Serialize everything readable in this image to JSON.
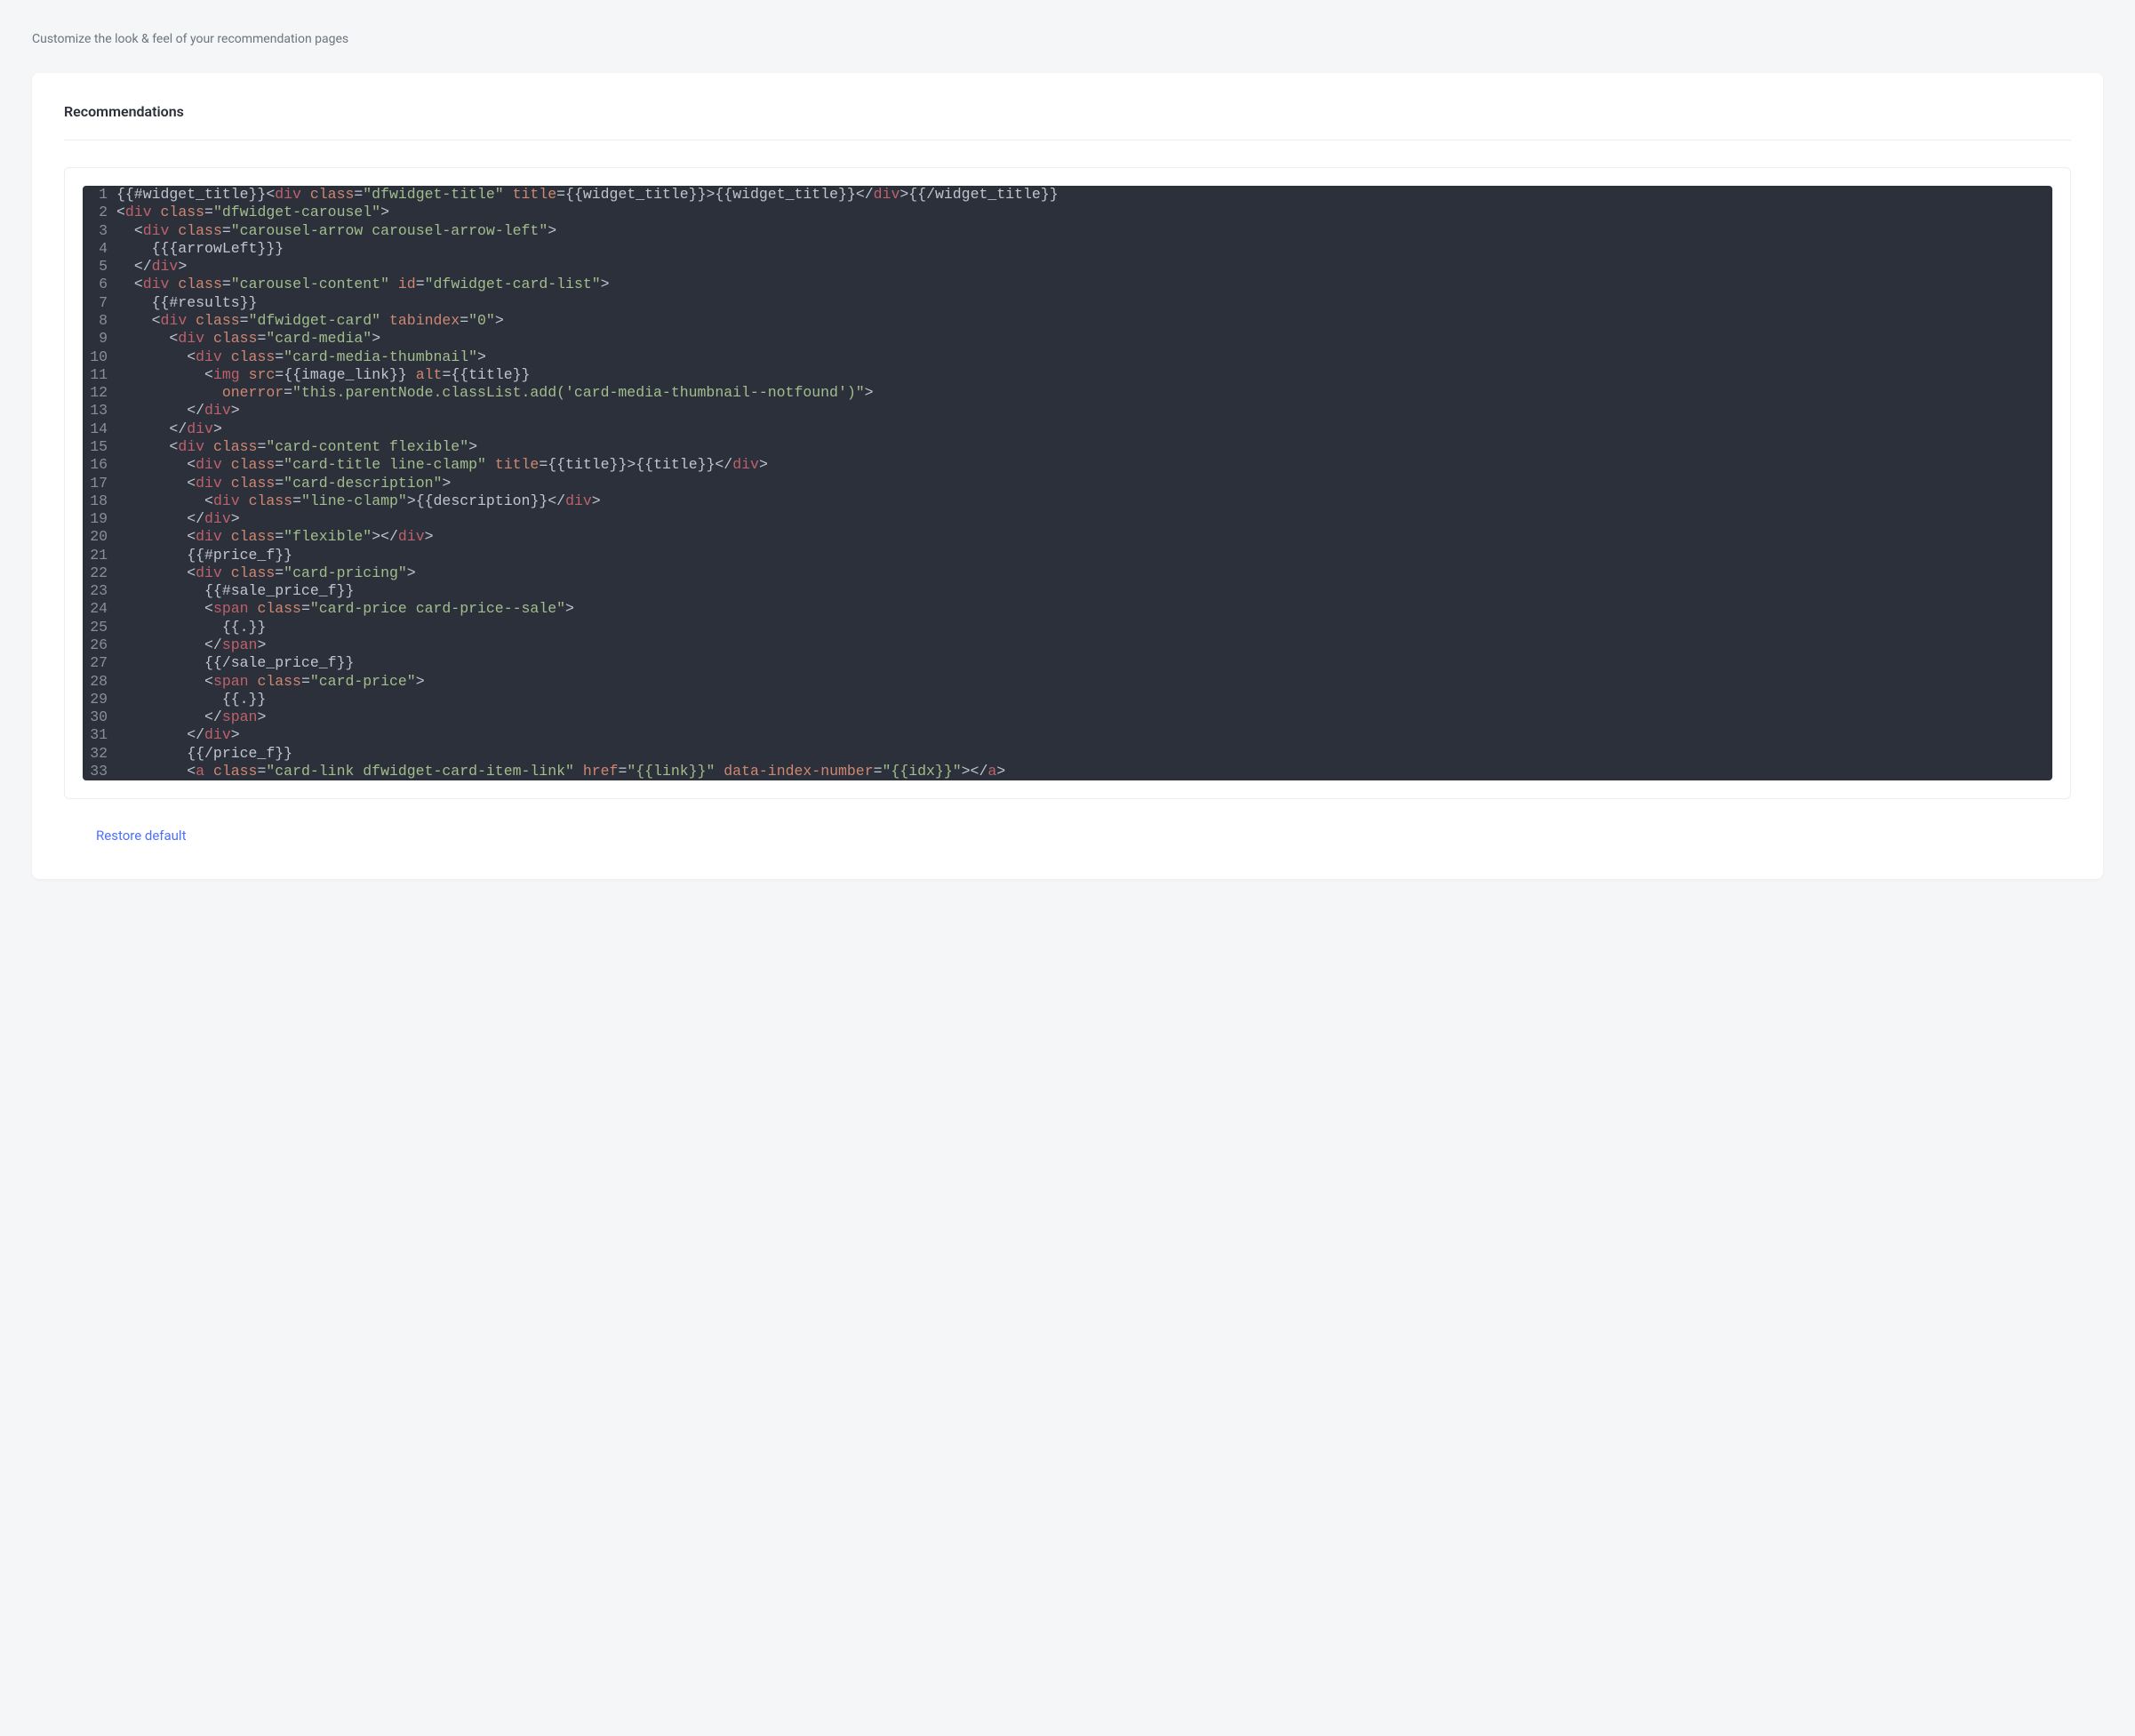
{
  "subtitle": "Customize the look & feel of your recommendation pages",
  "card_title": "Recommendations",
  "restore_label": "Restore default",
  "code_lines": [
    [
      {
        "t": "text",
        "v": "{{#widget_title}}"
      },
      {
        "t": "angle",
        "v": "<"
      },
      {
        "t": "tag",
        "v": "div"
      },
      {
        "t": "angle",
        "v": " "
      },
      {
        "t": "attr",
        "v": "class"
      },
      {
        "t": "angle",
        "v": "="
      },
      {
        "t": "val",
        "v": "\"dfwidget-title\""
      },
      {
        "t": "angle",
        "v": " "
      },
      {
        "t": "attr",
        "v": "title"
      },
      {
        "t": "angle",
        "v": "="
      },
      {
        "t": "text",
        "v": "{{widget_title}}"
      },
      {
        "t": "angle",
        "v": ">"
      },
      {
        "t": "text",
        "v": "{{widget_title}}"
      },
      {
        "t": "angle",
        "v": "</"
      },
      {
        "t": "tag",
        "v": "div"
      },
      {
        "t": "angle",
        "v": ">"
      },
      {
        "t": "text",
        "v": "{{/widget_title}}"
      }
    ],
    [
      {
        "t": "angle",
        "v": "<"
      },
      {
        "t": "tag",
        "v": "div"
      },
      {
        "t": "angle",
        "v": " "
      },
      {
        "t": "attr",
        "v": "class"
      },
      {
        "t": "angle",
        "v": "="
      },
      {
        "t": "val",
        "v": "\"dfwidget-carousel\""
      },
      {
        "t": "angle",
        "v": ">"
      }
    ],
    [
      {
        "t": "text",
        "v": "  "
      },
      {
        "t": "angle",
        "v": "<"
      },
      {
        "t": "tag",
        "v": "div"
      },
      {
        "t": "angle",
        "v": " "
      },
      {
        "t": "attr",
        "v": "class"
      },
      {
        "t": "angle",
        "v": "="
      },
      {
        "t": "val",
        "v": "\"carousel-arrow carousel-arrow-left\""
      },
      {
        "t": "angle",
        "v": ">"
      }
    ],
    [
      {
        "t": "text",
        "v": "    {{{arrowLeft}}}"
      }
    ],
    [
      {
        "t": "text",
        "v": "  "
      },
      {
        "t": "angle",
        "v": "</"
      },
      {
        "t": "tag",
        "v": "div"
      },
      {
        "t": "angle",
        "v": ">"
      }
    ],
    [
      {
        "t": "text",
        "v": "  "
      },
      {
        "t": "angle",
        "v": "<"
      },
      {
        "t": "tag",
        "v": "div"
      },
      {
        "t": "angle",
        "v": " "
      },
      {
        "t": "attr",
        "v": "class"
      },
      {
        "t": "angle",
        "v": "="
      },
      {
        "t": "val",
        "v": "\"carousel-content\""
      },
      {
        "t": "angle",
        "v": " "
      },
      {
        "t": "attr",
        "v": "id"
      },
      {
        "t": "angle",
        "v": "="
      },
      {
        "t": "val",
        "v": "\"dfwidget-card-list\""
      },
      {
        "t": "angle",
        "v": ">"
      }
    ],
    [
      {
        "t": "text",
        "v": "    {{#results}}"
      }
    ],
    [
      {
        "t": "text",
        "v": "    "
      },
      {
        "t": "angle",
        "v": "<"
      },
      {
        "t": "tag",
        "v": "div"
      },
      {
        "t": "angle",
        "v": " "
      },
      {
        "t": "attr",
        "v": "class"
      },
      {
        "t": "angle",
        "v": "="
      },
      {
        "t": "val",
        "v": "\"dfwidget-card\""
      },
      {
        "t": "angle",
        "v": " "
      },
      {
        "t": "attr",
        "v": "tabindex"
      },
      {
        "t": "angle",
        "v": "="
      },
      {
        "t": "val",
        "v": "\"0\""
      },
      {
        "t": "angle",
        "v": ">"
      }
    ],
    [
      {
        "t": "text",
        "v": "      "
      },
      {
        "t": "angle",
        "v": "<"
      },
      {
        "t": "tag",
        "v": "div"
      },
      {
        "t": "angle",
        "v": " "
      },
      {
        "t": "attr",
        "v": "class"
      },
      {
        "t": "angle",
        "v": "="
      },
      {
        "t": "val",
        "v": "\"card-media\""
      },
      {
        "t": "angle",
        "v": ">"
      }
    ],
    [
      {
        "t": "text",
        "v": "        "
      },
      {
        "t": "angle",
        "v": "<"
      },
      {
        "t": "tag",
        "v": "div"
      },
      {
        "t": "angle",
        "v": " "
      },
      {
        "t": "attr",
        "v": "class"
      },
      {
        "t": "angle",
        "v": "="
      },
      {
        "t": "val",
        "v": "\"card-media-thumbnail\""
      },
      {
        "t": "angle",
        "v": ">"
      }
    ],
    [
      {
        "t": "text",
        "v": "          "
      },
      {
        "t": "angle",
        "v": "<"
      },
      {
        "t": "tag",
        "v": "img"
      },
      {
        "t": "angle",
        "v": " "
      },
      {
        "t": "attr",
        "v": "src"
      },
      {
        "t": "angle",
        "v": "="
      },
      {
        "t": "text",
        "v": "{{image_link}}"
      },
      {
        "t": "angle",
        "v": " "
      },
      {
        "t": "attr",
        "v": "alt"
      },
      {
        "t": "angle",
        "v": "="
      },
      {
        "t": "text",
        "v": "{{title}}"
      }
    ],
    [
      {
        "t": "text",
        "v": "            "
      },
      {
        "t": "attr",
        "v": "onerror"
      },
      {
        "t": "angle",
        "v": "="
      },
      {
        "t": "val",
        "v": "\"this.parentNode.classList.add('card-media-thumbnail--notfound')\""
      },
      {
        "t": "angle",
        "v": ">"
      }
    ],
    [
      {
        "t": "text",
        "v": "        "
      },
      {
        "t": "angle",
        "v": "</"
      },
      {
        "t": "tag",
        "v": "div"
      },
      {
        "t": "angle",
        "v": ">"
      }
    ],
    [
      {
        "t": "text",
        "v": "      "
      },
      {
        "t": "angle",
        "v": "</"
      },
      {
        "t": "tag",
        "v": "div"
      },
      {
        "t": "angle",
        "v": ">"
      }
    ],
    [
      {
        "t": "text",
        "v": "      "
      },
      {
        "t": "angle",
        "v": "<"
      },
      {
        "t": "tag",
        "v": "div"
      },
      {
        "t": "angle",
        "v": " "
      },
      {
        "t": "attr",
        "v": "class"
      },
      {
        "t": "angle",
        "v": "="
      },
      {
        "t": "val",
        "v": "\"card-content flexible\""
      },
      {
        "t": "angle",
        "v": ">"
      }
    ],
    [
      {
        "t": "text",
        "v": "        "
      },
      {
        "t": "angle",
        "v": "<"
      },
      {
        "t": "tag",
        "v": "div"
      },
      {
        "t": "angle",
        "v": " "
      },
      {
        "t": "attr",
        "v": "class"
      },
      {
        "t": "angle",
        "v": "="
      },
      {
        "t": "val",
        "v": "\"card-title line-clamp\""
      },
      {
        "t": "angle",
        "v": " "
      },
      {
        "t": "attr",
        "v": "title"
      },
      {
        "t": "angle",
        "v": "="
      },
      {
        "t": "text",
        "v": "{{title}}"
      },
      {
        "t": "angle",
        "v": ">"
      },
      {
        "t": "text",
        "v": "{{title}}"
      },
      {
        "t": "angle",
        "v": "</"
      },
      {
        "t": "tag",
        "v": "div"
      },
      {
        "t": "angle",
        "v": ">"
      }
    ],
    [
      {
        "t": "text",
        "v": "        "
      },
      {
        "t": "angle",
        "v": "<"
      },
      {
        "t": "tag",
        "v": "div"
      },
      {
        "t": "angle",
        "v": " "
      },
      {
        "t": "attr",
        "v": "class"
      },
      {
        "t": "angle",
        "v": "="
      },
      {
        "t": "val",
        "v": "\"card-description\""
      },
      {
        "t": "angle",
        "v": ">"
      }
    ],
    [
      {
        "t": "text",
        "v": "          "
      },
      {
        "t": "angle",
        "v": "<"
      },
      {
        "t": "tag",
        "v": "div"
      },
      {
        "t": "angle",
        "v": " "
      },
      {
        "t": "attr",
        "v": "class"
      },
      {
        "t": "angle",
        "v": "="
      },
      {
        "t": "val",
        "v": "\"line-clamp\""
      },
      {
        "t": "angle",
        "v": ">"
      },
      {
        "t": "text",
        "v": "{{description}}"
      },
      {
        "t": "angle",
        "v": "</"
      },
      {
        "t": "tag",
        "v": "div"
      },
      {
        "t": "angle",
        "v": ">"
      }
    ],
    [
      {
        "t": "text",
        "v": "        "
      },
      {
        "t": "angle",
        "v": "</"
      },
      {
        "t": "tag",
        "v": "div"
      },
      {
        "t": "angle",
        "v": ">"
      }
    ],
    [
      {
        "t": "text",
        "v": "        "
      },
      {
        "t": "angle",
        "v": "<"
      },
      {
        "t": "tag",
        "v": "div"
      },
      {
        "t": "angle",
        "v": " "
      },
      {
        "t": "attr",
        "v": "class"
      },
      {
        "t": "angle",
        "v": "="
      },
      {
        "t": "val",
        "v": "\"flexible\""
      },
      {
        "t": "angle",
        "v": ">"
      },
      {
        "t": "angle",
        "v": "</"
      },
      {
        "t": "tag",
        "v": "div"
      },
      {
        "t": "angle",
        "v": ">"
      }
    ],
    [
      {
        "t": "text",
        "v": "        {{#price_f}}"
      }
    ],
    [
      {
        "t": "text",
        "v": "        "
      },
      {
        "t": "angle",
        "v": "<"
      },
      {
        "t": "tag",
        "v": "div"
      },
      {
        "t": "angle",
        "v": " "
      },
      {
        "t": "attr",
        "v": "class"
      },
      {
        "t": "angle",
        "v": "="
      },
      {
        "t": "val",
        "v": "\"card-pricing\""
      },
      {
        "t": "angle",
        "v": ">"
      }
    ],
    [
      {
        "t": "text",
        "v": "          {{#sale_price_f}}"
      }
    ],
    [
      {
        "t": "text",
        "v": "          "
      },
      {
        "t": "angle",
        "v": "<"
      },
      {
        "t": "tag",
        "v": "span"
      },
      {
        "t": "angle",
        "v": " "
      },
      {
        "t": "attr",
        "v": "class"
      },
      {
        "t": "angle",
        "v": "="
      },
      {
        "t": "val",
        "v": "\"card-price card-price--sale\""
      },
      {
        "t": "angle",
        "v": ">"
      }
    ],
    [
      {
        "t": "text",
        "v": "            {{.}}"
      }
    ],
    [
      {
        "t": "text",
        "v": "          "
      },
      {
        "t": "angle",
        "v": "</"
      },
      {
        "t": "tag",
        "v": "span"
      },
      {
        "t": "angle",
        "v": ">"
      }
    ],
    [
      {
        "t": "text",
        "v": "          {{/sale_price_f}}"
      }
    ],
    [
      {
        "t": "text",
        "v": "          "
      },
      {
        "t": "angle",
        "v": "<"
      },
      {
        "t": "tag",
        "v": "span"
      },
      {
        "t": "angle",
        "v": " "
      },
      {
        "t": "attr",
        "v": "class"
      },
      {
        "t": "angle",
        "v": "="
      },
      {
        "t": "val",
        "v": "\"card-price\""
      },
      {
        "t": "angle",
        "v": ">"
      }
    ],
    [
      {
        "t": "text",
        "v": "            {{.}}"
      }
    ],
    [
      {
        "t": "text",
        "v": "          "
      },
      {
        "t": "angle",
        "v": "</"
      },
      {
        "t": "tag",
        "v": "span"
      },
      {
        "t": "angle",
        "v": ">"
      }
    ],
    [
      {
        "t": "text",
        "v": "        "
      },
      {
        "t": "angle",
        "v": "</"
      },
      {
        "t": "tag",
        "v": "div"
      },
      {
        "t": "angle",
        "v": ">"
      }
    ],
    [
      {
        "t": "text",
        "v": "        {{/price_f}}"
      }
    ],
    [
      {
        "t": "text",
        "v": "        "
      },
      {
        "t": "angle",
        "v": "<"
      },
      {
        "t": "tag",
        "v": "a"
      },
      {
        "t": "angle",
        "v": " "
      },
      {
        "t": "attr",
        "v": "class"
      },
      {
        "t": "angle",
        "v": "="
      },
      {
        "t": "val",
        "v": "\"card-link dfwidget-card-item-link\""
      },
      {
        "t": "angle",
        "v": " "
      },
      {
        "t": "attr",
        "v": "href"
      },
      {
        "t": "angle",
        "v": "="
      },
      {
        "t": "val",
        "v": "\"{{link}}\""
      },
      {
        "t": "angle",
        "v": " "
      },
      {
        "t": "attr",
        "v": "data-index-number"
      },
      {
        "t": "angle",
        "v": "="
      },
      {
        "t": "val",
        "v": "\"{{idx}}\""
      },
      {
        "t": "angle",
        "v": ">"
      },
      {
        "t": "angle",
        "v": "</"
      },
      {
        "t": "tag",
        "v": "a"
      },
      {
        "t": "angle",
        "v": ">"
      }
    ]
  ]
}
